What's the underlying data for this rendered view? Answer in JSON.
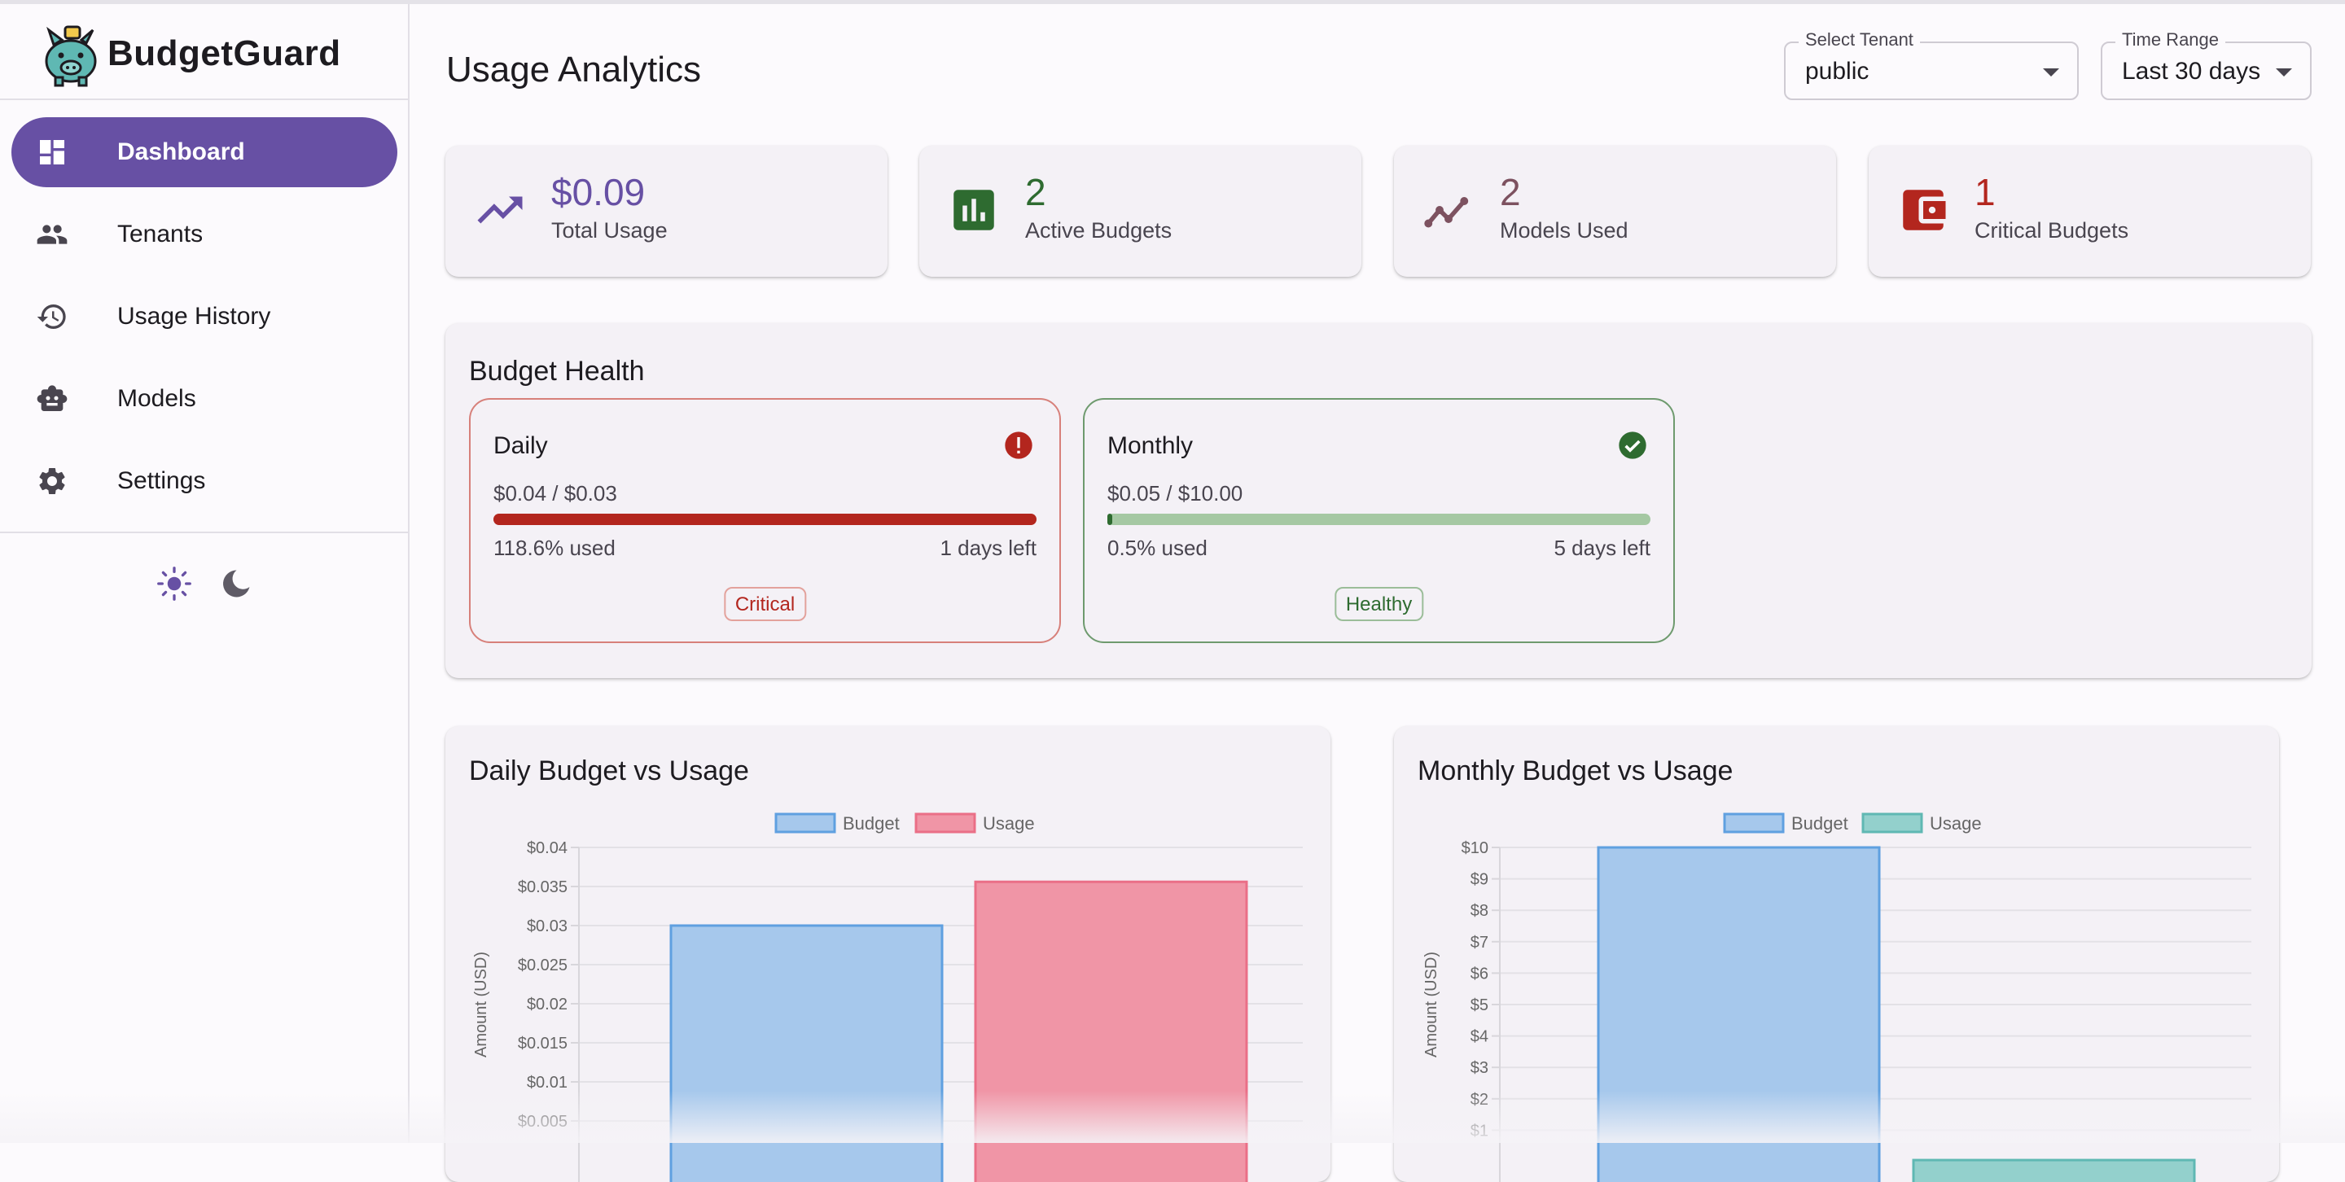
{
  "app": {
    "name": "BudgetGuard"
  },
  "sidebar": {
    "items": [
      {
        "label": "Dashboard",
        "icon": "dashboard-icon",
        "active": true
      },
      {
        "label": "Tenants",
        "icon": "people-icon",
        "active": false
      },
      {
        "label": "Usage History",
        "icon": "history-icon",
        "active": false
      },
      {
        "label": "Models",
        "icon": "robot-icon",
        "active": false
      },
      {
        "label": "Settings",
        "icon": "gear-icon",
        "active": false
      }
    ],
    "theme": {
      "light_icon": "sun-icon",
      "dark_icon": "moon-icon",
      "selected": "light"
    }
  },
  "header": {
    "title": "Usage Analytics",
    "tenant_select": {
      "label": "Select Tenant",
      "value": "public"
    },
    "time_select": {
      "label": "Time Range",
      "value": "Last 30 days"
    }
  },
  "stats": [
    {
      "value": "$0.09",
      "label": "Total Usage",
      "icon": "trending-up-icon",
      "color": "#6750a4"
    },
    {
      "value": "2",
      "label": "Active Budgets",
      "icon": "bar-chart-icon",
      "color": "#2e6b30"
    },
    {
      "value": "2",
      "label": "Models Used",
      "icon": "line-graph-icon",
      "color": "#7d5260"
    },
    {
      "value": "1",
      "label": "Critical Budgets",
      "icon": "wallet-icon",
      "color": "#b3261e"
    }
  ],
  "budget_health": {
    "title": "Budget Health",
    "items": [
      {
        "name": "Daily",
        "amount": "$0.04 / $0.03",
        "used": "118.6% used",
        "left": "1 days left",
        "status": "Critical",
        "status_icon": "alert-icon",
        "progress": 1.0,
        "color": "#b3261e",
        "track": "#e8b4b0"
      },
      {
        "name": "Monthly",
        "amount": "$0.05 / $10.00",
        "used": "0.5% used",
        "left": "5 days left",
        "status": "Healthy",
        "status_icon": "check-circle-icon",
        "progress": 0.005,
        "color": "#2e6b30",
        "track": "#a5c8a3"
      }
    ]
  },
  "chart_data": [
    {
      "type": "bar",
      "title": "Daily Budget vs Usage",
      "ylabel": "Amount (USD)",
      "categories": [
        ""
      ],
      "series": [
        {
          "name": "Budget",
          "values": [
            0.03
          ],
          "color": "#a6c8ec",
          "border": "#5fa0e0"
        },
        {
          "name": "Usage",
          "values": [
            0.0356
          ],
          "color": "#f095a6",
          "border": "#ea6f87"
        }
      ],
      "ylim": [
        0,
        0.04
      ],
      "yticks": [
        "$0.04",
        "$0.035",
        "$0.03",
        "$0.025",
        "$0.02",
        "$0.015",
        "$0.01",
        "$0.005"
      ],
      "ytick_values": [
        0.04,
        0.035,
        0.03,
        0.025,
        0.02,
        0.015,
        0.01,
        0.005
      ],
      "legend": "top-center",
      "grid": true
    },
    {
      "type": "bar",
      "title": "Monthly Budget vs Usage",
      "ylabel": "Amount (USD)",
      "categories": [
        ""
      ],
      "series": [
        {
          "name": "Budget",
          "values": [
            10
          ],
          "color": "#a6c8ec",
          "border": "#5fa0e0"
        },
        {
          "name": "Usage",
          "values": [
            0.05
          ],
          "color": "#93d0cc",
          "border": "#5fb8b3"
        }
      ],
      "ylim": [
        0,
        10
      ],
      "yticks": [
        "$10",
        "$9",
        "$8",
        "$7",
        "$6",
        "$5",
        "$4",
        "$3",
        "$2",
        "$1"
      ],
      "ytick_values": [
        10,
        9,
        8,
        7,
        6,
        5,
        4,
        3,
        2,
        1
      ],
      "legend": "top-center",
      "grid": true
    }
  ]
}
